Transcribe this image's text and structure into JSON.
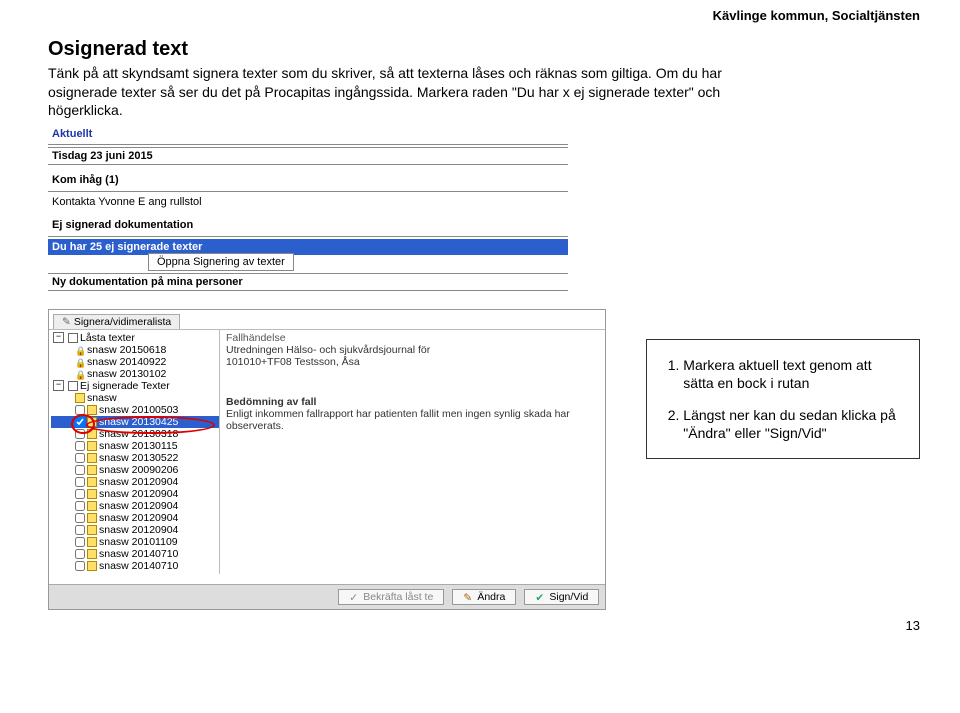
{
  "header": {
    "top_right": "Kävlinge kommun, Socialtjänsten"
  },
  "title": "Osignerad text",
  "intro": {
    "p1": "Tänk på att skyndsamt signera texter som du skriver, så att texterna låses och räknas som giltiga. Om du har",
    "p2": "osignerade texter så ser du det på Procapitas ingångssida. Markera raden \"Du har x ej signerade texter\" och",
    "p3": "högerklicka."
  },
  "shot1": {
    "aktuellt": "Aktuellt",
    "date_row": "Tisdag 23 juni 2015",
    "kom_ihag": "Kom ihåg   (1)",
    "kom_item": "Kontakta Yvonne E ang rullstol",
    "ejsign": "Ej signerad dokumentation",
    "ejsign_item": "Du har 25 ej signerade texter",
    "context_menu": "Öppna Signering av texter",
    "nydok": "Ny dokumentation på mina personer"
  },
  "shot2": {
    "tab_label": "Signera/vidimeralista",
    "tree": {
      "lasta": "Låsta texter",
      "ejsign": "Ej signerade Texter",
      "items_locked": [
        "snasw 20150618",
        "snasw 20140922",
        "snasw 20130102"
      ],
      "unsign_first": "snasw",
      "items_unsigned": [
        "snasw 20100503",
        "snasw 20130425",
        "snasw 20130318",
        "snasw 20130115",
        "snasw 20130522",
        "snasw 20090206",
        "snasw 20120904",
        "snasw 20120904",
        "snasw 20120904",
        "snasw 20120904",
        "snasw 20120904",
        "snasw 20101109",
        "snasw 20140710",
        "snasw 20140710"
      ],
      "selected_index": 1
    },
    "content": {
      "fallhandelse_label": "Fallhändelse",
      "fallhandelse_text1": "Utredningen Hälso- och sjukvårdsjournal för",
      "fallhandelse_text2": "101010+TF08 Testsson, Åsa",
      "bedomning_label": "Bedömning av fall",
      "bedomning_text": "Enligt inkommen fallrapport har patienten fallit men ingen synlig skada har observerats."
    },
    "buttons": {
      "bekrafta": "Bekräfta låst te",
      "andra": "Ändra",
      "signvid": "Sign/Vid"
    }
  },
  "sidebox": {
    "item1": "Markera aktuell text genom att sätta en bock i rutan",
    "item2": "Längst ner kan du sedan klicka på \"Ändra\" eller \"Sign/Vid\""
  },
  "page_num": "13"
}
